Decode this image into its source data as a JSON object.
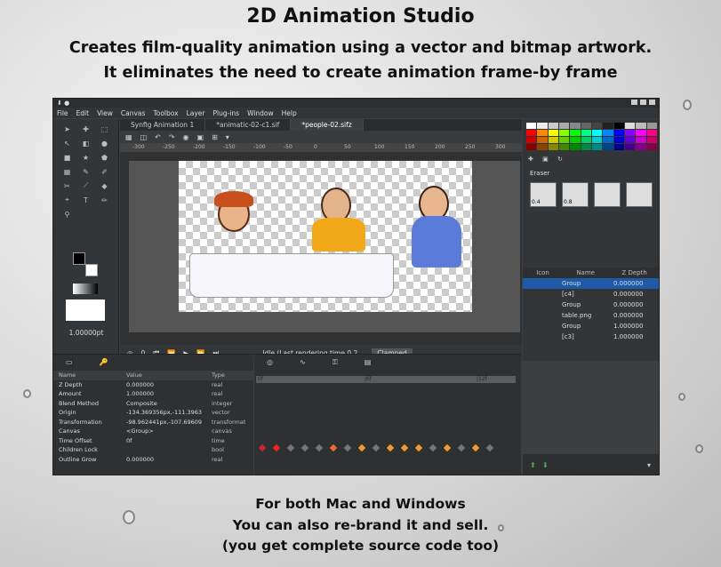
{
  "header": {
    "title": "2D Animation Studio",
    "subtitle_line1": "Creates film-quality animation using a vector and bitmap artwork.",
    "subtitle_line2": "It eliminates the need to create animation frame-by frame"
  },
  "footer": {
    "line1": "For both Mac and Windows",
    "line2": "You can also re-brand it and sell.",
    "line3": "(you get complete source code too)"
  },
  "app": {
    "menu": [
      "File",
      "Edit",
      "View",
      "Canvas",
      "Toolbox",
      "Layer",
      "Plug-ins",
      "Window",
      "Help"
    ],
    "tabs": [
      "Synfig Animation 1",
      "*animatic-02-c1.sif",
      "*people-02.sifz"
    ],
    "ruler_ticks": [
      "-300",
      "-250",
      "-200",
      "-150",
      "-100",
      "-50",
      "0",
      "50",
      "100",
      "150",
      "200",
      "250",
      "300"
    ],
    "width_value": "1.00000pt",
    "playbar": {
      "frame": "0",
      "status": "Idle (Last rendering time 0.2...",
      "interpolation": "Clamped"
    },
    "tool_options": {
      "tool_name": "Eraser",
      "brush_sizes": [
        "0.4",
        "0.8"
      ]
    },
    "layers": {
      "columns": [
        "Icon",
        "Name",
        "Z Depth"
      ],
      "rows": [
        {
          "name": "Group",
          "z": "0.000000"
        },
        {
          "name": "[c4]",
          "z": "0.000000"
        },
        {
          "name": "Group",
          "z": "0.000000"
        },
        {
          "name": "table.png",
          "z": "0.000000"
        },
        {
          "name": "Group",
          "z": "1.000000"
        },
        {
          "name": "[c3]",
          "z": "1.000000"
        }
      ]
    },
    "params": {
      "columns": [
        "Name",
        "Value",
        "Type"
      ],
      "rows": [
        {
          "name": "Z Depth",
          "value": "0.000000",
          "type": "real"
        },
        {
          "name": "Amount",
          "value": "1.000000",
          "type": "real"
        },
        {
          "name": "Blend Method",
          "value": "Composite",
          "type": "integer"
        },
        {
          "name": "Origin",
          "value": "-134.369356px,-111.3963",
          "type": "vector"
        },
        {
          "name": "Transformation",
          "value": "-98.962441px,-107.69609",
          "type": "transformat"
        },
        {
          "name": "Canvas",
          "value": "<Group>",
          "type": "canvas"
        },
        {
          "name": "Time Offset",
          "value": "0f",
          "type": "time"
        },
        {
          "name": "Children Lock",
          "value": "",
          "type": "bool"
        },
        {
          "name": "Outline Grow",
          "value": "0.000000",
          "type": "real"
        }
      ]
    },
    "timeline_labels": [
      "0f",
      "|6f",
      "|12f"
    ]
  }
}
